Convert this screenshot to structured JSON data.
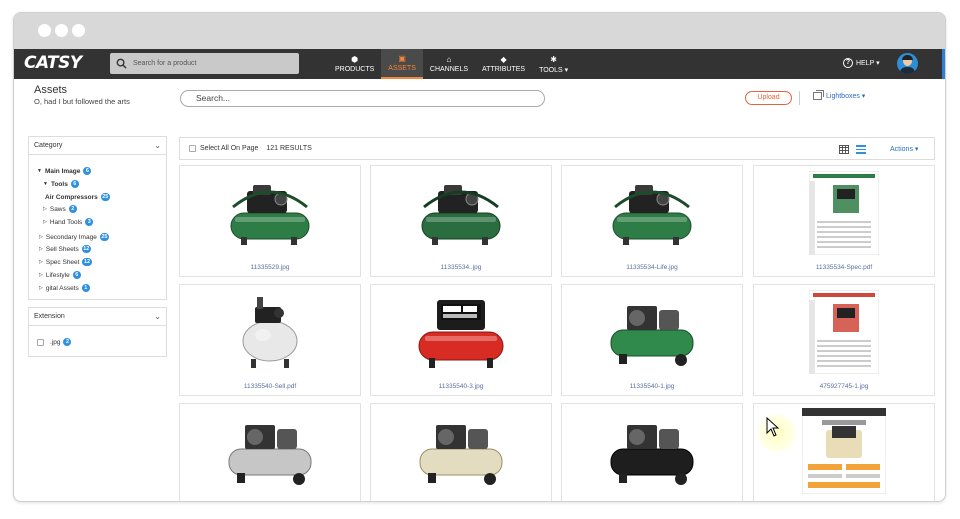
{
  "window": {
    "dots": 3
  },
  "nav": {
    "logo": "CATSY",
    "search_placeholder": "Search for a product",
    "items": [
      {
        "label": "PRODUCTS",
        "icon": "cube-icon",
        "glyph": "⬢"
      },
      {
        "label": "ASSETS",
        "icon": "image-icon",
        "glyph": "▣",
        "active": true
      },
      {
        "label": "CHANNELS",
        "icon": "store-icon",
        "glyph": "⌂"
      },
      {
        "label": "ATTRIBUTES",
        "icon": "tag-icon",
        "glyph": "◆"
      },
      {
        "label": "TOOLS ▾",
        "icon": "gear-icon",
        "glyph": "✱"
      }
    ],
    "help": "HELP ▾",
    "accent": "#f5873a"
  },
  "page": {
    "title": "Assets",
    "subtitle": "O, had I but followed the arts",
    "search_placeholder": "Search...",
    "upload": "Upload",
    "lightboxes": "Lightboxes ▾"
  },
  "sidebar": {
    "category_title": "Category",
    "tree": [
      {
        "label": "Main Image",
        "count": "6",
        "bold": true,
        "arrow": "▼"
      },
      {
        "label": "Tools",
        "count": "6",
        "bold": true,
        "arrow": "▼"
      },
      {
        "label": "Air Compressors",
        "count": "25",
        "bold": true,
        "arrow": ""
      },
      {
        "label": "Saws",
        "count": "2",
        "bold": false,
        "arrow": "▷"
      },
      {
        "label": "Hand Tools",
        "count": "3",
        "bold": false,
        "arrow": "▷"
      },
      {
        "label": "Secondary Image",
        "count": "25",
        "bold": false,
        "arrow": "▷"
      },
      {
        "label": "Sell Sheets",
        "count": "12",
        "bold": false,
        "arrow": "▷"
      },
      {
        "label": "Spec Sheet",
        "count": "12",
        "bold": false,
        "arrow": "▷"
      },
      {
        "label": "Lifestyle",
        "count": "6",
        "bold": false,
        "arrow": "▷"
      },
      {
        "label": "gital Assets",
        "count": "1",
        "bold": false,
        "arrow": "▷"
      }
    ],
    "extension_title": "Extension",
    "extensions": [
      {
        "label": ".jpg",
        "count": "2"
      }
    ]
  },
  "results": {
    "select_all": "Select All On Page",
    "count": "121 RESULTS",
    "actions": "Actions ▾"
  },
  "assets": [
    {
      "filename": "11335529.jpg",
      "kind": "compressor-green"
    },
    {
      "filename": "11335534..jpg",
      "kind": "compressor-green-front"
    },
    {
      "filename": "11335534-Life.jpg",
      "kind": "compressor-green-side"
    },
    {
      "filename": "11335534-Spec.pdf",
      "kind": "spec-sheet"
    },
    {
      "filename": "11335540-Sell.pdf",
      "kind": "compressor-white"
    },
    {
      "filename": "11335540-3.jpg",
      "kind": "compressor-red"
    },
    {
      "filename": "11335540-1.jpg",
      "kind": "compressor-green-tall"
    },
    {
      "filename": "475927745-1.jpg",
      "kind": "spec-sheet-red"
    },
    {
      "filename": "",
      "kind": "compressor-silver"
    },
    {
      "filename": "",
      "kind": "compressor-beige"
    },
    {
      "filename": "",
      "kind": "compressor-black"
    },
    {
      "filename": "",
      "kind": "sell-sheet"
    }
  ],
  "colors": {
    "nav_bg": "#333333",
    "link": "#2f6fb8",
    "badge": "#2f8fe0",
    "upload": "#e8613a"
  }
}
